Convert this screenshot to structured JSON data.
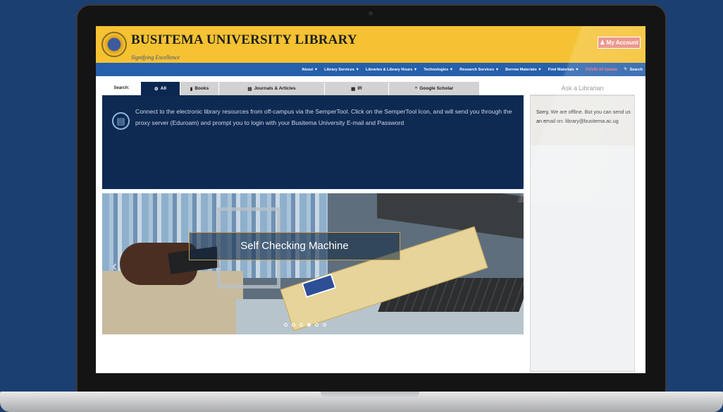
{
  "header": {
    "title": "BUSITEMA UNIVERSITY LIBRARY",
    "tagline": "Signifying Excellence",
    "account_label": "My Account",
    "account_icon": "user-icon"
  },
  "nav": {
    "items": [
      {
        "label": "About ▼"
      },
      {
        "label": "Library Services ▼"
      },
      {
        "label": "Libraries & Library Hours ▼"
      },
      {
        "label": "Technologies ▼"
      },
      {
        "label": "Research Services ▼"
      },
      {
        "label": "Borrow Materials ▼"
      },
      {
        "label": "Find Materials ▼"
      },
      {
        "label": "COVID-19 Update"
      },
      {
        "label": "Search"
      }
    ],
    "highlight_color": "#ff6d6d",
    "search_icon": "search-icon"
  },
  "search": {
    "label": "Search:",
    "tabs": [
      {
        "label": "All",
        "icon": "globe-icon",
        "active": true
      },
      {
        "label": "Books",
        "icon": "book-icon",
        "active": false
      },
      {
        "label": "Journals & Articles",
        "icon": "newspaper-icon",
        "active": false
      },
      {
        "label": "IR",
        "icon": "database-icon",
        "active": false
      },
      {
        "label": "Google Scholar",
        "icon": "graduation-cap-icon",
        "active": false
      }
    ]
  },
  "info": {
    "icon": "door-icon",
    "text": "Connect to the electronic library resources from off-campus via the SemperTool. Click on the SemperTool Icon, and will send you through the proxy server (Eduroam) and prompt you to login with your Busitema University E-mail and Password"
  },
  "carousel": {
    "caption": "Self Checking Machine",
    "dots": 6,
    "active_dot": 4,
    "prev_icon": "chevron-left-icon"
  },
  "sidebar": {
    "title": "Ask a Librarian",
    "message": "Sorry, We are offline. But you can send us an email on: library@busitema.ac.ug"
  },
  "colors": {
    "header_bg": "#f4c232",
    "nav_bg": "#2660ac",
    "panel_bg": "#0e2a52",
    "page_bg": "#1c3f72"
  }
}
